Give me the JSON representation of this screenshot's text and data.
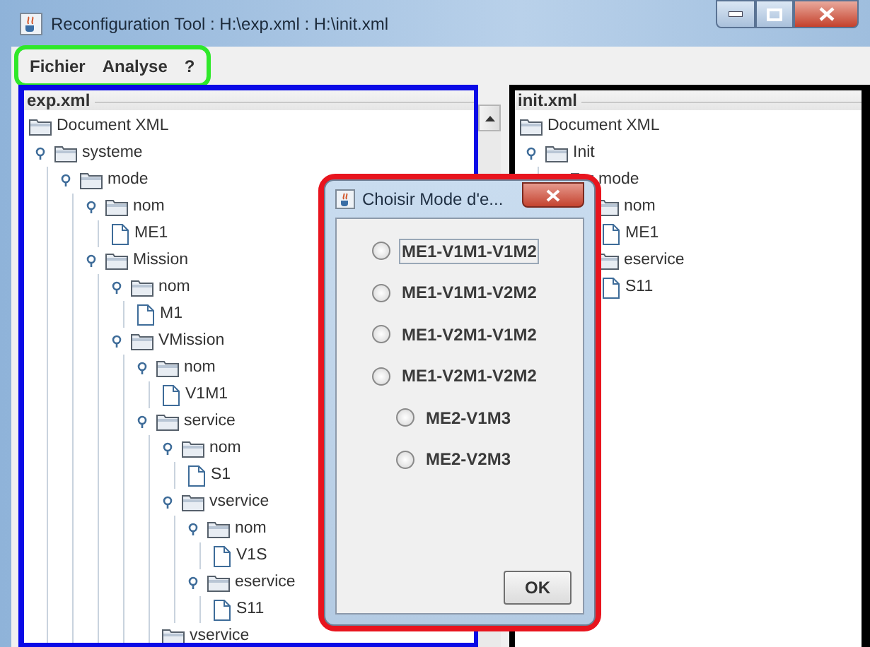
{
  "window": {
    "title": "Reconfiguration Tool : H:\\exp.xml : H:\\init.xml"
  },
  "menu": [
    "Fichier",
    "Analyse",
    "?"
  ],
  "left_pane": {
    "title": "exp.xml",
    "tree": [
      {
        "kind": "folder",
        "label": "Document XML",
        "children": [
          {
            "kind": "folder",
            "label": "systeme",
            "children": [
              {
                "kind": "folder",
                "label": "mode",
                "children": [
                  {
                    "kind": "folder",
                    "label": "nom",
                    "children": [
                      {
                        "kind": "file",
                        "label": "ME1"
                      }
                    ]
                  },
                  {
                    "kind": "folder",
                    "label": "Mission",
                    "children": [
                      {
                        "kind": "folder",
                        "label": "nom",
                        "children": [
                          {
                            "kind": "file",
                            "label": "M1"
                          }
                        ]
                      },
                      {
                        "kind": "folder",
                        "label": "VMission",
                        "children": [
                          {
                            "kind": "folder",
                            "label": "nom",
                            "children": [
                              {
                                "kind": "file",
                                "label": "V1M1"
                              }
                            ]
                          },
                          {
                            "kind": "folder",
                            "label": "service",
                            "children": [
                              {
                                "kind": "folder",
                                "label": "nom",
                                "children": [
                                  {
                                    "kind": "file",
                                    "label": "S1"
                                  }
                                ]
                              },
                              {
                                "kind": "folder",
                                "label": "vservice",
                                "children": [
                                  {
                                    "kind": "folder",
                                    "label": "nom",
                                    "children": [
                                      {
                                        "kind": "file",
                                        "label": "V1S"
                                      }
                                    ]
                                  },
                                  {
                                    "kind": "folder",
                                    "label": "eservice",
                                    "children": [
                                      {
                                        "kind": "file",
                                        "label": "S11"
                                      }
                                    ]
                                  }
                                ]
                              },
                              {
                                "kind": "folder",
                                "label": "vservice"
                              }
                            ]
                          }
                        ]
                      }
                    ]
                  }
                ]
              }
            ]
          }
        ]
      }
    ]
  },
  "right_pane": {
    "title": "init.xml",
    "tree": [
      {
        "kind": "folder",
        "label": "Document XML",
        "children": [
          {
            "kind": "folder",
            "label": "Init",
            "children": [
              {
                "kind": "folder",
                "label": "mode",
                "children": [
                  {
                    "kind": "folder",
                    "label": "nom",
                    "children": [
                      {
                        "kind": "file",
                        "label": "ME1"
                      }
                    ]
                  },
                  {
                    "kind": "folder",
                    "label": "eservice",
                    "children": [
                      {
                        "kind": "file",
                        "label": "S11"
                      }
                    ]
                  }
                ]
              }
            ]
          }
        ]
      }
    ]
  },
  "dialog": {
    "title": "Choisir Mode d'e...",
    "options": [
      {
        "label": "ME1-V1M1-V1M2",
        "selected": false,
        "focused": true
      },
      {
        "label": "ME1-V1M1-V2M2",
        "selected": false,
        "focused": false
      },
      {
        "label": "ME1-V2M1-V1M2",
        "selected": false,
        "focused": false
      },
      {
        "label": "ME1-V2M1-V2M2",
        "selected": false,
        "focused": false
      },
      {
        "label": "ME2-V1M3",
        "selected": false,
        "focused": false
      },
      {
        "label": "ME2-V2M3",
        "selected": false,
        "focused": false
      }
    ],
    "button": "OK"
  }
}
